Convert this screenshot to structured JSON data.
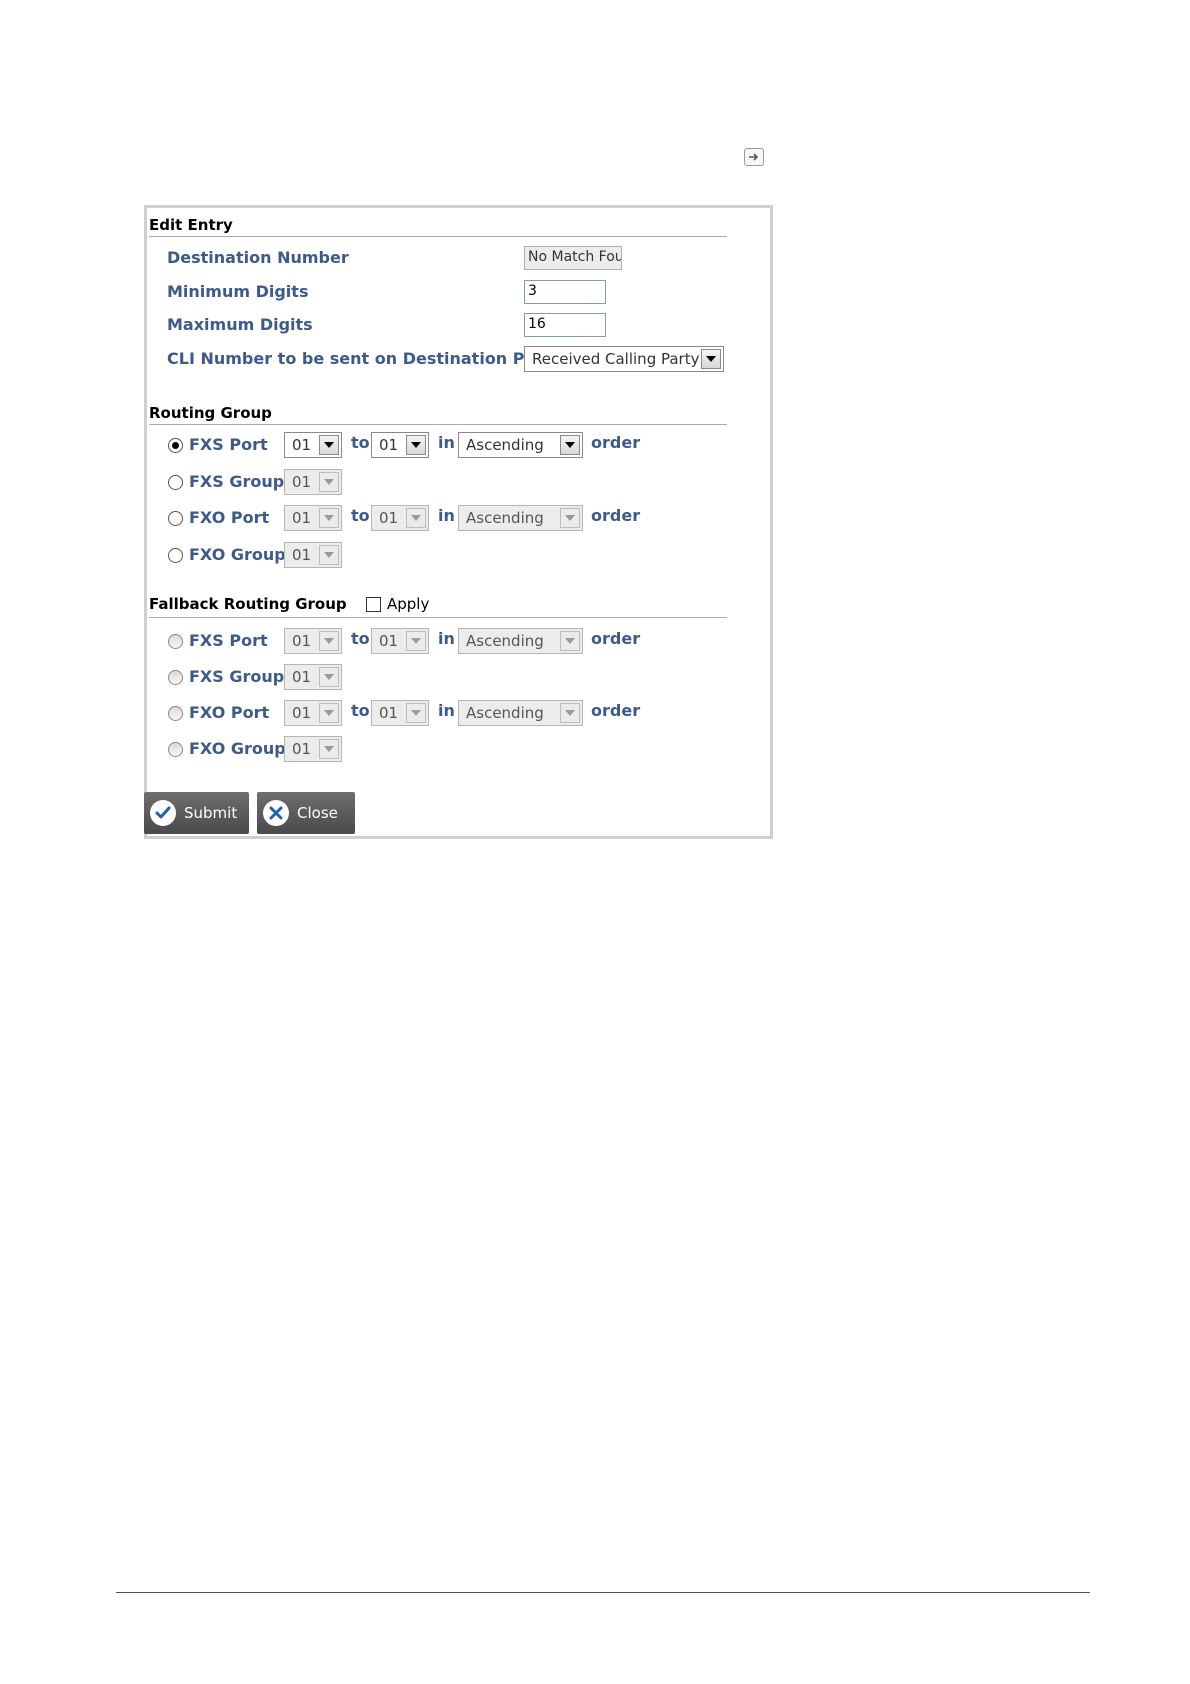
{
  "edit_entry": {
    "title": "Edit Entry",
    "destination_number": {
      "label": "Destination Number",
      "value": "No Match Found"
    },
    "minimum_digits": {
      "label": "Minimum Digits",
      "value": "3"
    },
    "maximum_digits": {
      "label": "Maximum Digits",
      "value": "16"
    },
    "cli_number": {
      "label": "CLI Number to be sent on Destination Port",
      "value": "Received Calling Party"
    }
  },
  "routing_group": {
    "title": "Routing Group",
    "to_label": "to",
    "in_label": "in",
    "order_label": "order",
    "fxs_port": {
      "label": "FXS Port",
      "from": "01",
      "to": "01",
      "order": "Ascending",
      "selected": true
    },
    "fxs_group": {
      "label": "FXS Group",
      "value": "01"
    },
    "fxo_port": {
      "label": "FXO Port",
      "from": "01",
      "to": "01",
      "order": "Ascending"
    },
    "fxo_group": {
      "label": "FXO Group",
      "value": "01"
    }
  },
  "fallback_routing_group": {
    "title": "Fallback Routing Group",
    "apply_label": "Apply",
    "apply_checked": false,
    "to_label": "to",
    "in_label": "in",
    "order_label": "order",
    "fxs_port": {
      "label": "FXS Port",
      "from": "01",
      "to": "01",
      "order": "Ascending"
    },
    "fxs_group": {
      "label": "FXS Group",
      "value": "01"
    },
    "fxo_port": {
      "label": "FXO Port",
      "from": "01",
      "to": "01",
      "order": "Ascending"
    },
    "fxo_group": {
      "label": "FXO Group",
      "value": "01"
    }
  },
  "buttons": {
    "submit": "Submit",
    "close": "Close"
  },
  "icons": {
    "exit": "exit-arrow-icon",
    "submit": "check-icon",
    "close": "close-x-icon"
  },
  "colors": {
    "label": "#3c5a8c",
    "button": "#5a5a5a",
    "panel_border": "#cfcfcf"
  }
}
